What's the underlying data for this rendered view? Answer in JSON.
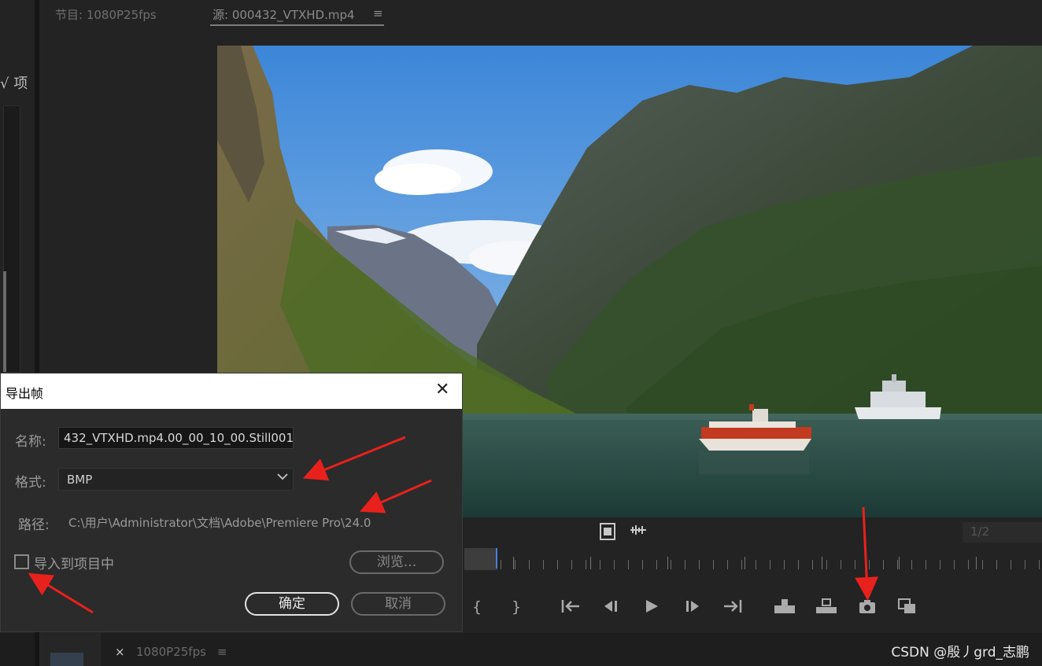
{
  "left_panel": {
    "project_label": "√ 项"
  },
  "monitor": {
    "tab_program": "节目: 1080P25fps",
    "tab_source": "源: 000432_VTXHD.mp4",
    "tab_menu": "≡",
    "fraction": "1/2"
  },
  "controls": {
    "mark_in": "{",
    "mark_out": "}"
  },
  "bottom": {
    "close": "×",
    "sequence": "1080P25fps",
    "menu": "≡",
    "watermark": "CSDN @殷丿grd_志鹏"
  },
  "dialog": {
    "title": "导出帧",
    "close": "✕",
    "name_label": "名称:",
    "name_value": "432_VTXHD.mp4.00_00_10_00.Still001",
    "format_label": "格式:",
    "format_value": "BMP",
    "path_label": "路径:",
    "path_value": "C:\\用户\\Administrator\\文档\\Adobe\\Premiere Pro\\24.0",
    "import_label": "导入到项目中",
    "import_checked": false,
    "browse": "浏览...",
    "ok": "确定",
    "cancel": "取消"
  },
  "colors": {
    "annotation_arrow": "#e8211d",
    "panel_bg": "#232323",
    "dialog_bg": "#2b2b2b",
    "playhead": "#4b7fd6"
  }
}
